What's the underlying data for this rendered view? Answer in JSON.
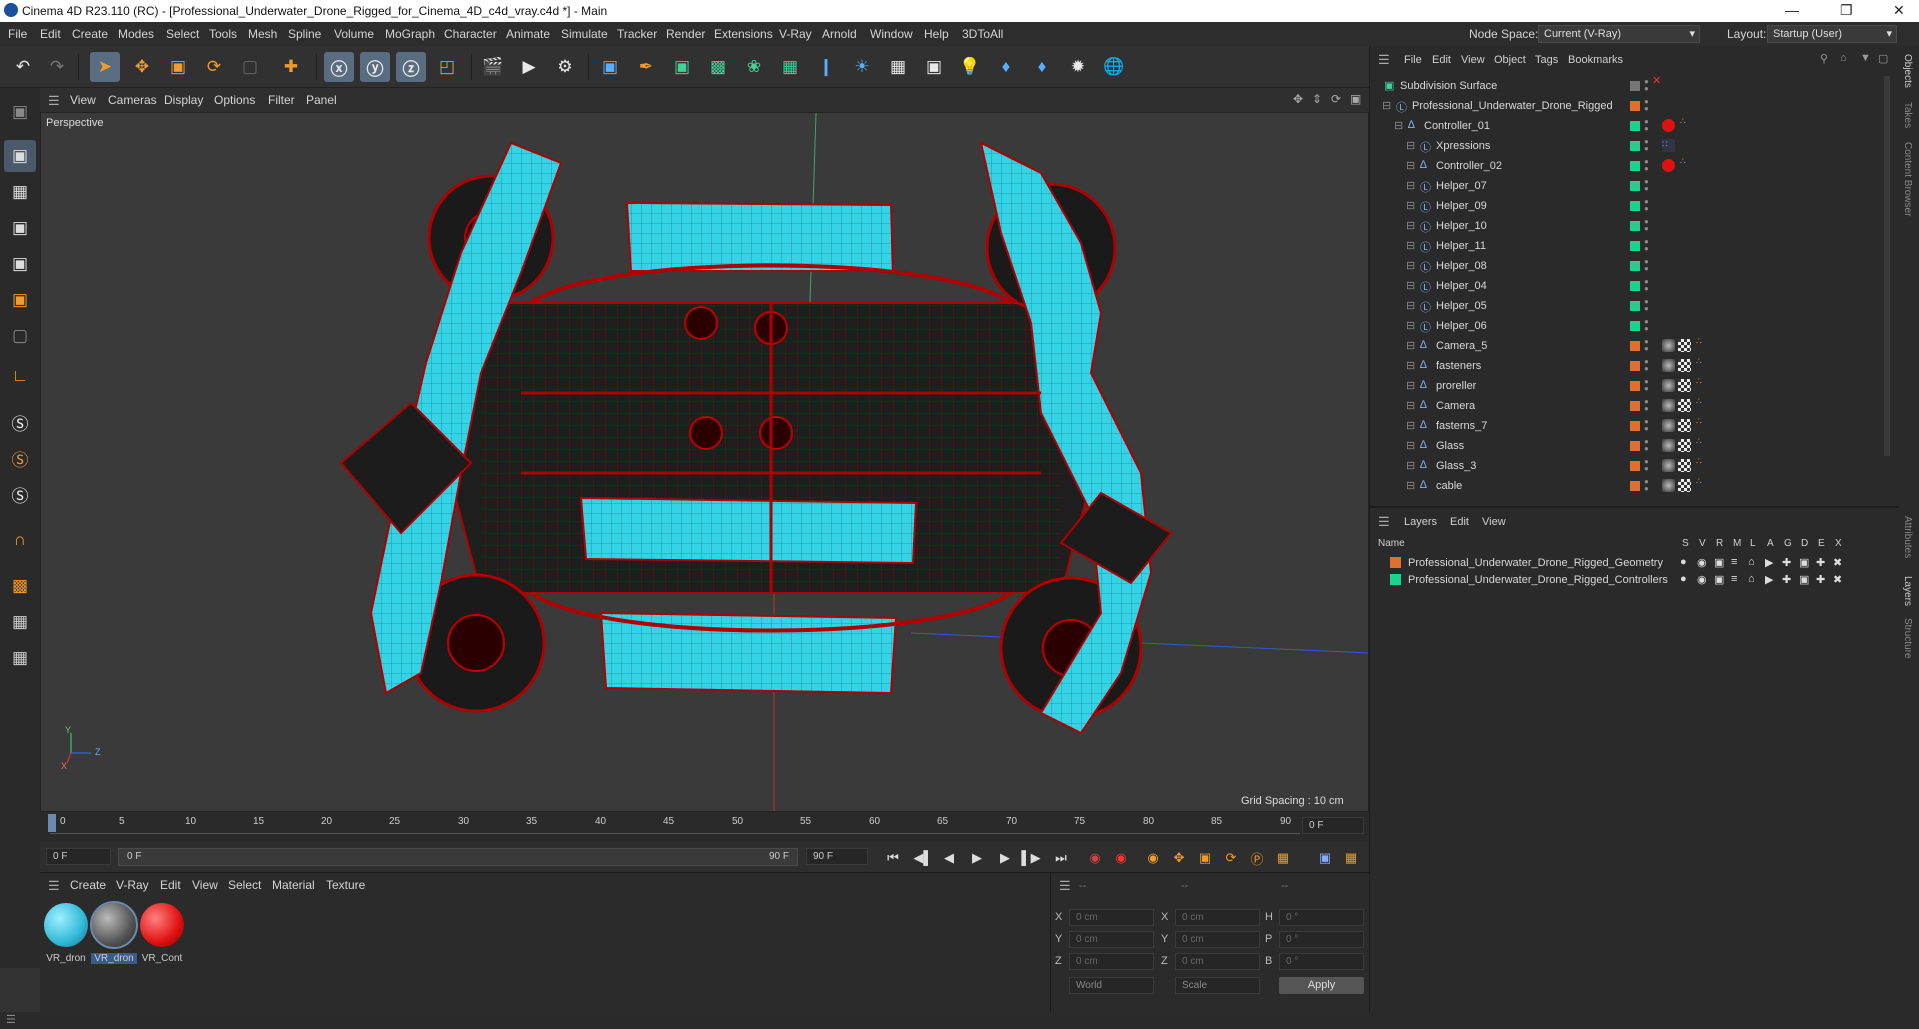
{
  "app": {
    "title": "Cinema 4D R23.110 (RC) - [Professional_Underwater_Drone_Rigged_for_Cinema_4D_c4d_vray.c4d *] - Main",
    "node_space_label": "Node Space:",
    "node_space_value": "Current (V-Ray)",
    "layout_label": "Layout:",
    "layout_value": "Startup (User)"
  },
  "menu": [
    "File",
    "Edit",
    "Create",
    "Modes",
    "Select",
    "Tools",
    "Mesh",
    "Spline",
    "Volume",
    "MoGraph",
    "Character",
    "Animate",
    "Simulate",
    "Tracker",
    "Render",
    "Extensions",
    "V-Ray",
    "Arnold",
    "Window",
    "Help",
    "3DToAll"
  ],
  "viewport": {
    "menu": [
      "View",
      "Cameras",
      "Display",
      "Options",
      "Filter",
      "Panel"
    ],
    "label": "Perspective",
    "grid_spacing": "Grid Spacing : 10 cm",
    "axis_y": "Y",
    "axis_z": "Z",
    "axis_x": "X"
  },
  "timeline": {
    "ticks": [
      "0",
      "5",
      "10",
      "15",
      "20",
      "25",
      "30",
      "35",
      "40",
      "45",
      "50",
      "55",
      "60",
      "65",
      "70",
      "75",
      "80",
      "85",
      "90"
    ],
    "current_frame": "0 F",
    "start_field": "0 F",
    "range_start": "0 F",
    "range_end": "90 F",
    "end_field": "90 F"
  },
  "materials": {
    "menu": [
      "Create",
      "V-Ray",
      "Edit",
      "View",
      "Select",
      "Material",
      "Texture"
    ],
    "items": [
      {
        "label": "VR_dron",
        "color": "#40c8e0"
      },
      {
        "label": "VR_dron",
        "color": "#555555"
      },
      {
        "label": "VR_Cont",
        "color": "#e01010"
      }
    ]
  },
  "coords": {
    "headers": [
      "--",
      "--",
      "--"
    ],
    "rows": [
      {
        "a": "X",
        "av": "0 cm",
        "b": "X",
        "bv": "0 cm",
        "c": "H",
        "cv": "0 °"
      },
      {
        "a": "Y",
        "av": "0 cm",
        "b": "Y",
        "bv": "0 cm",
        "c": "P",
        "cv": "0 °"
      },
      {
        "a": "Z",
        "av": "0 cm",
        "b": "Z",
        "bv": "0 cm",
        "c": "B",
        "cv": "0 °"
      }
    ],
    "space": "World",
    "mode": "Scale",
    "apply": "Apply"
  },
  "objects": {
    "menu": [
      "File",
      "Edit",
      "View",
      "Object",
      "Tags",
      "Bookmarks"
    ],
    "items": [
      {
        "name": "Subdivision Surface",
        "indent": 0,
        "layer": "",
        "icon": "subdivision-icon"
      },
      {
        "name": "Professional_Underwater_Drone_Rigged",
        "indent": 1,
        "layer": "#e07030",
        "icon": "null-icon"
      },
      {
        "name": "Controller_01",
        "indent": 2,
        "layer": "#20d090",
        "icon": "joint-icon",
        "tag": "red"
      },
      {
        "name": "Xpressions",
        "indent": 3,
        "layer": "#20d090",
        "icon": "null-icon",
        "tag": "xpresso"
      },
      {
        "name": "Controller_02",
        "indent": 3,
        "layer": "#20d090",
        "icon": "joint-icon",
        "tag": "red"
      },
      {
        "name": "Helper_07",
        "indent": 3,
        "layer": "#20d090",
        "icon": "null-icon"
      },
      {
        "name": "Helper_09",
        "indent": 3,
        "layer": "#20d090",
        "icon": "null-icon"
      },
      {
        "name": "Helper_10",
        "indent": 3,
        "layer": "#20d090",
        "icon": "null-icon"
      },
      {
        "name": "Helper_11",
        "indent": 3,
        "layer": "#20d090",
        "icon": "null-icon"
      },
      {
        "name": "Helper_08",
        "indent": 3,
        "layer": "#20d090",
        "icon": "null-icon"
      },
      {
        "name": "Helper_04",
        "indent": 3,
        "layer": "#20d090",
        "icon": "null-icon"
      },
      {
        "name": "Helper_05",
        "indent": 3,
        "layer": "#20d090",
        "icon": "null-icon"
      },
      {
        "name": "Helper_06",
        "indent": 3,
        "layer": "#20d090",
        "icon": "null-icon"
      },
      {
        "name": "Camera_5",
        "indent": 3,
        "layer": "#e07030",
        "icon": "joint-icon",
        "tag": "mat"
      },
      {
        "name": "fasteners",
        "indent": 3,
        "layer": "#e07030",
        "icon": "joint-icon",
        "tag": "mat"
      },
      {
        "name": "proreller",
        "indent": 3,
        "layer": "#e07030",
        "icon": "joint-icon",
        "tag": "mat"
      },
      {
        "name": "Camera",
        "indent": 3,
        "layer": "#e07030",
        "icon": "joint-icon",
        "tag": "mat"
      },
      {
        "name": "fasterns_7",
        "indent": 3,
        "layer": "#e07030",
        "icon": "joint-icon",
        "tag": "mat"
      },
      {
        "name": "Glass",
        "indent": 3,
        "layer": "#e07030",
        "icon": "joint-icon",
        "tag": "mat"
      },
      {
        "name": "Glass_3",
        "indent": 3,
        "layer": "#e07030",
        "icon": "joint-icon",
        "tag": "mat"
      },
      {
        "name": "cable",
        "indent": 3,
        "layer": "#e07030",
        "icon": "joint-icon",
        "tag": "mat"
      }
    ]
  },
  "layers": {
    "menu": [
      "Layers",
      "Edit",
      "View"
    ],
    "col_name": "Name",
    "col_flags": [
      "S",
      "V",
      "R",
      "M",
      "L",
      "A",
      "G",
      "D",
      "E",
      "X"
    ],
    "items": [
      {
        "name": "Professional_Underwater_Drone_Rigged_Geometry",
        "color": "#e07030"
      },
      {
        "name": "Professional_Underwater_Drone_Rigged_Controllers",
        "color": "#20d090"
      }
    ]
  },
  "side_tabs": [
    "Objects",
    "Takes",
    "Content Browser",
    "Attributes",
    "Layers",
    "Structure"
  ]
}
